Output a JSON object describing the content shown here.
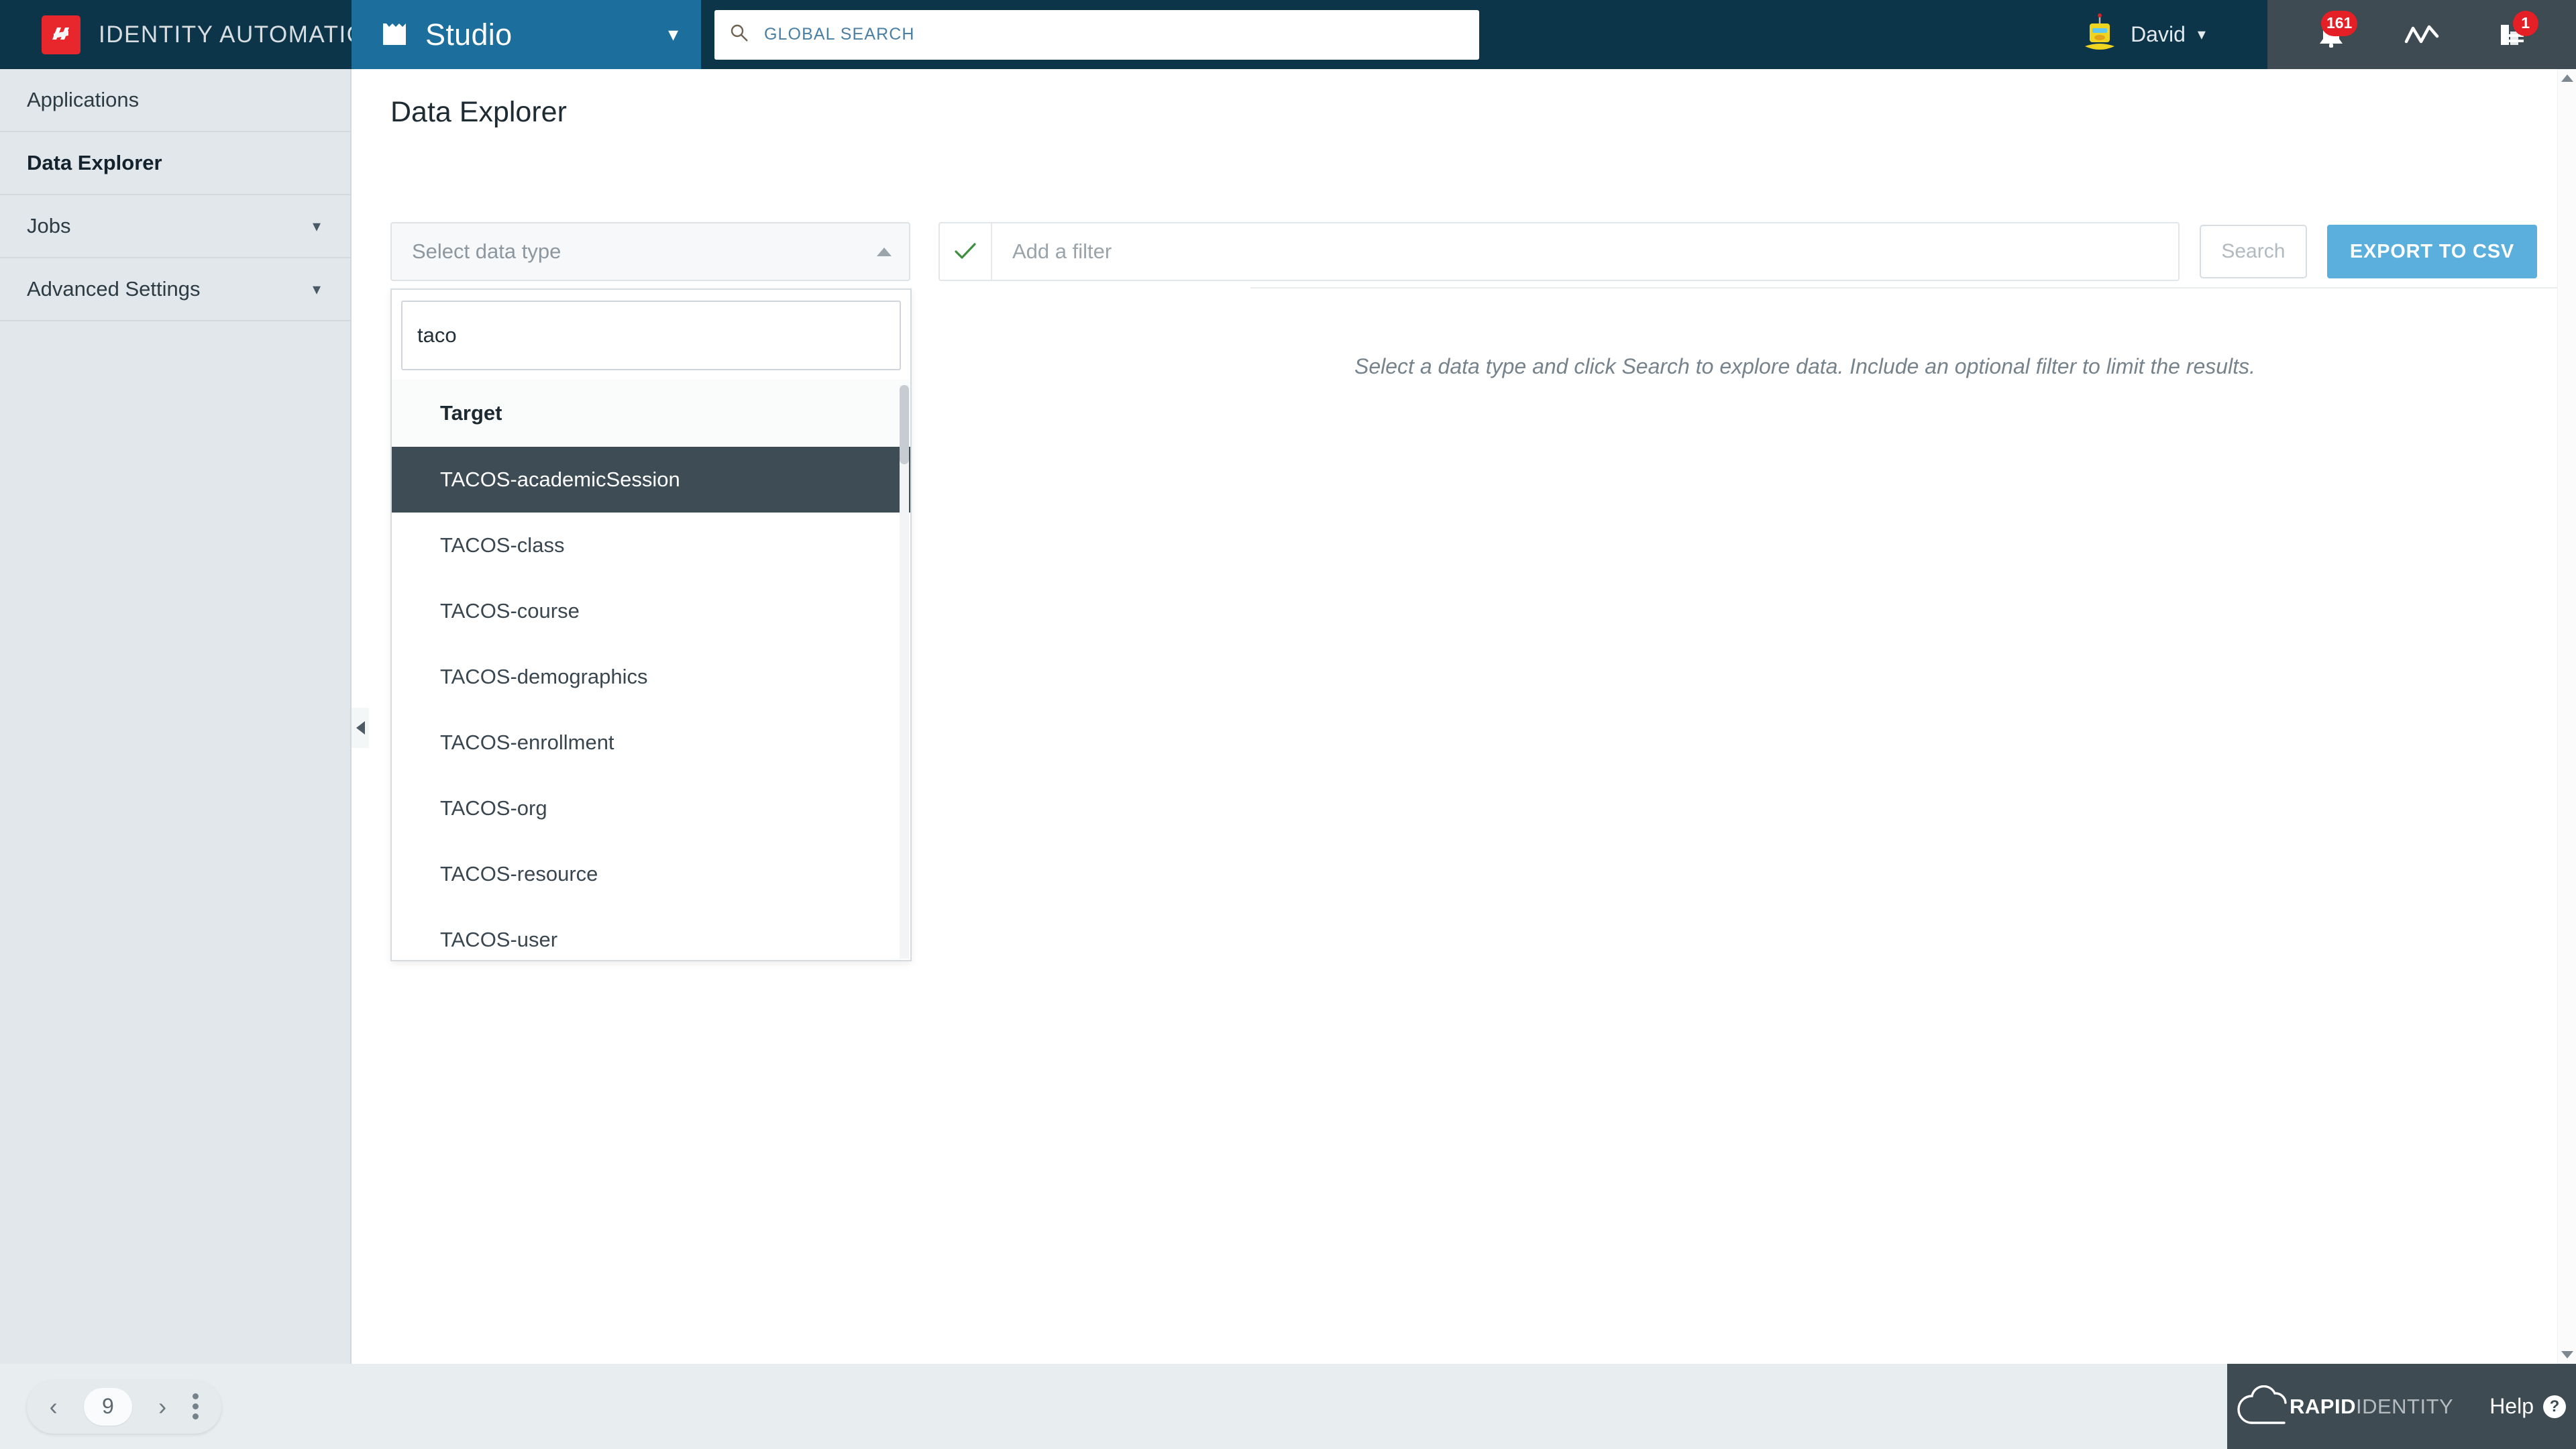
{
  "header": {
    "brand_name": "IDENTITY AUTOMATION",
    "brand_logo_icon": "identity-automation-logo",
    "app_name": "Studio",
    "app_icon": "book-icon",
    "app_caret_icon": "chevron-down-icon",
    "search": {
      "icon": "search-icon",
      "placeholder": "GLOBAL SEARCH",
      "value": ""
    },
    "user": {
      "avatar_icon": "robot-avatar",
      "name": "David",
      "caret_icon": "chevron-down-icon"
    },
    "icons": [
      {
        "name": "bell-icon",
        "badge": "161"
      },
      {
        "name": "activity-chart-icon",
        "badge": ""
      },
      {
        "name": "reports-bar-icon",
        "badge": "1"
      }
    ]
  },
  "sidebar": {
    "items": [
      {
        "label": "Applications",
        "active": false,
        "expandable": false
      },
      {
        "label": "Data Explorer",
        "active": true,
        "expandable": false
      },
      {
        "label": "Jobs",
        "active": false,
        "expandable": true
      },
      {
        "label": "Advanced Settings",
        "active": false,
        "expandable": true
      }
    ],
    "collapse_icon": "collapse-left-icon"
  },
  "main": {
    "page_title": "Data Explorer",
    "data_type_select": {
      "placeholder": "Select data type",
      "value": "",
      "arrow_icon": "caret-up-icon",
      "expanded": true
    },
    "filter": {
      "check_icon": "check-icon",
      "placeholder": "Add a filter",
      "value": ""
    },
    "search_button": "Search",
    "export_button": "EXPORT TO CSV",
    "empty_message": "Select a data type and click Search to explore data. Include an optional filter to limit the results."
  },
  "dropdown": {
    "search_value": "taco",
    "search_placeholder": "",
    "groups": [
      {
        "label": "Target",
        "items": [
          {
            "label": "TACOS-academicSession",
            "selected": true
          },
          {
            "label": "TACOS-class",
            "selected": false
          },
          {
            "label": "TACOS-course",
            "selected": false
          },
          {
            "label": "TACOS-demographics",
            "selected": false
          },
          {
            "label": "TACOS-enrollment",
            "selected": false
          },
          {
            "label": "TACOS-org",
            "selected": false
          },
          {
            "label": "TACOS-resource",
            "selected": false
          },
          {
            "label": "TACOS-user",
            "selected": false
          }
        ]
      }
    ]
  },
  "footer": {
    "nav": {
      "back_icon": "chevron-left-icon",
      "forward_icon": "chevron-right-icon",
      "page_number": "9",
      "menu_icon": "kebab-menu-icon"
    },
    "logo_bold": "RAPID",
    "logo_light": "IDENTITY",
    "logo_icon": "cloud-icon",
    "help_label": "Help",
    "help_icon": "question-mark-icon"
  },
  "colors": {
    "brand_dark": "#0c3549",
    "studio_blue": "#1c6e9c",
    "slate": "#3e4b52",
    "accent_red": "#e8272c",
    "badge_red": "#e41f26",
    "export_blue": "#5bafdc",
    "selected_row": "#3d4c55",
    "sidebar_bg": "#e1e7ea"
  }
}
